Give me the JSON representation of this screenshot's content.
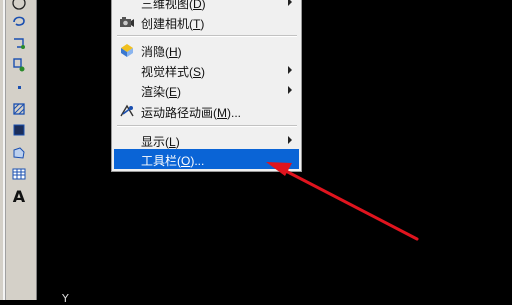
{
  "menu": {
    "items": [
      {
        "label": "三维视图(",
        "shortcut": "D",
        "suffix": ")",
        "has_submenu": true
      },
      {
        "label": "创建相机(",
        "shortcut": "T",
        "suffix": ")",
        "has_submenu": false
      },
      {
        "label": "消隐(",
        "shortcut": "H",
        "suffix": ")",
        "has_submenu": false
      },
      {
        "label": "视觉样式(",
        "shortcut": "S",
        "suffix": ")",
        "has_submenu": true
      },
      {
        "label": "渲染(",
        "shortcut": "E",
        "suffix": ")",
        "has_submenu": true
      },
      {
        "label": "运动路径动画(",
        "shortcut": "M",
        "suffix": ")...",
        "has_submenu": false
      },
      {
        "label": "显示(",
        "shortcut": "L",
        "suffix": ")",
        "has_submenu": true
      },
      {
        "label": "工具栏(",
        "shortcut": "O",
        "suffix": ")...",
        "has_submenu": false,
        "highlighted": true
      }
    ]
  },
  "toolbar": {
    "text_tool": "A"
  },
  "canvas": {
    "axis_label": "Y"
  },
  "colors": {
    "highlight": "#0a64d6",
    "annotation_arrow": "#e0141e",
    "toolbar_bg": "#d4d0c8",
    "canvas_bg": "#000000"
  }
}
